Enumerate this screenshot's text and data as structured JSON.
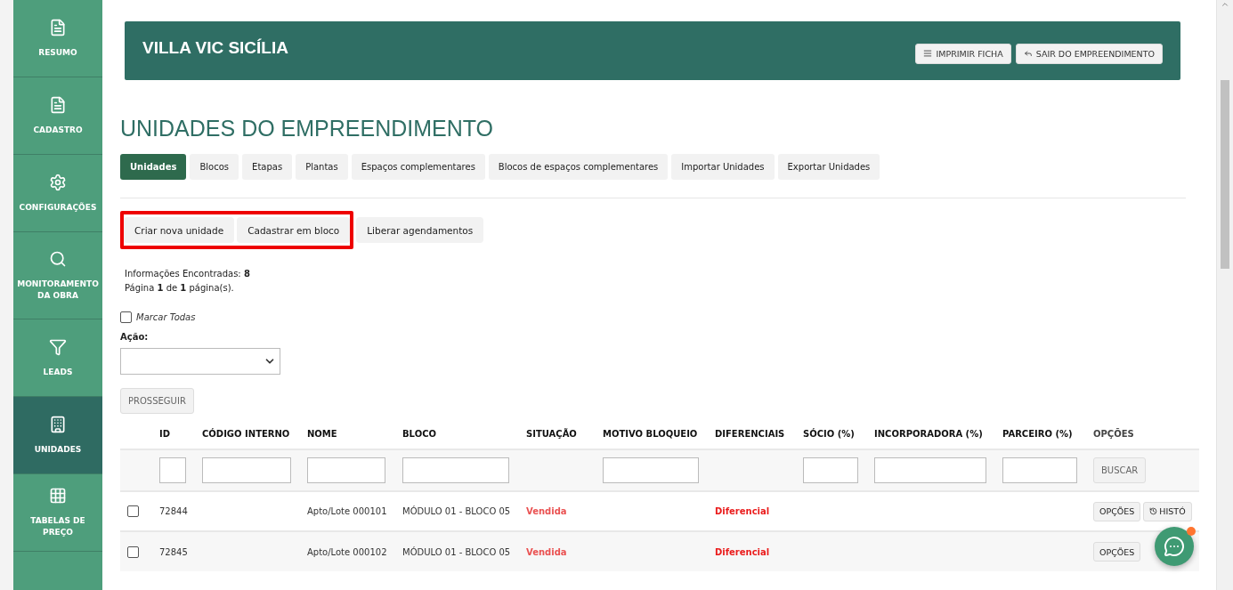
{
  "sidebar": {
    "items": [
      {
        "label": "RESUMO",
        "selected": false
      },
      {
        "label": "CADASTRO",
        "selected": false
      },
      {
        "label": "CONFIGURAÇÕES",
        "selected": false
      },
      {
        "label": "MONITORAMENTO DA OBRA",
        "selected": false
      },
      {
        "label": "LEADS",
        "selected": false
      },
      {
        "label": "UNIDADES",
        "selected": true
      },
      {
        "label": "TABELAS DE PREÇO",
        "selected": false
      }
    ]
  },
  "banner": {
    "title": "VILLA VIC SICÍLIA",
    "buttons": [
      "IMPRIMIR FICHA",
      "SAIR DO EMPREENDIMENTO"
    ]
  },
  "page_title": "UNIDADES DO EMPREENDIMENTO",
  "tabs": [
    {
      "label": "Unidades",
      "selected": true
    },
    {
      "label": "Blocos",
      "selected": false
    },
    {
      "label": "Etapas",
      "selected": false
    },
    {
      "label": "Plantas",
      "selected": false
    },
    {
      "label": "Espaços complementares",
      "selected": false
    },
    {
      "label": "Blocos de espaços complementares",
      "selected": false
    },
    {
      "label": "Importar Unidades",
      "selected": false
    },
    {
      "label": "Exportar Unidades",
      "selected": false
    }
  ],
  "action_buttons": {
    "highlighted": [
      "Criar nova unidade",
      "Cadastrar em bloco"
    ],
    "plain": [
      "Liberar agendamentos"
    ]
  },
  "info": {
    "found": "Informações Encontradas: **8**",
    "pages": "Página **1** de **1** página(s)."
  },
  "mark_all": {
    "label": "Marcar Todas",
    "checked": false
  },
  "action": {
    "label": "Ação:",
    "button": "PROSSEGUIR"
  },
  "table": {
    "columns": [
      "ID",
      "CÓDIGO INTERNO",
      "NOME",
      "BLOCO",
      "SITUAÇÃO",
      "MOTIVO BLOQUEIO",
      "DIFERENCIAIS",
      "SÓCIO (%)",
      "INCORPORADORA (%)",
      "PARCEIRO (%)",
      "OPÇÕES"
    ],
    "search_button": "BUSCAR",
    "rows": [
      {
        "checked": false,
        "id": "72844",
        "name": "Apto/Lote 000101",
        "block": "MÓDULO 01 - BLOCO 05",
        "status": "Vendida",
        "features": "Diferencial",
        "options": "OPÇÕES",
        "history": "HISTÓ"
      },
      {
        "checked": false,
        "id": "72845",
        "name": "Apto/Lote 000102",
        "block": "MÓDULO 01 - BLOCO 05",
        "status": "Vendida",
        "features": "Diferencial",
        "options": "OPÇÕES"
      }
    ]
  }
}
